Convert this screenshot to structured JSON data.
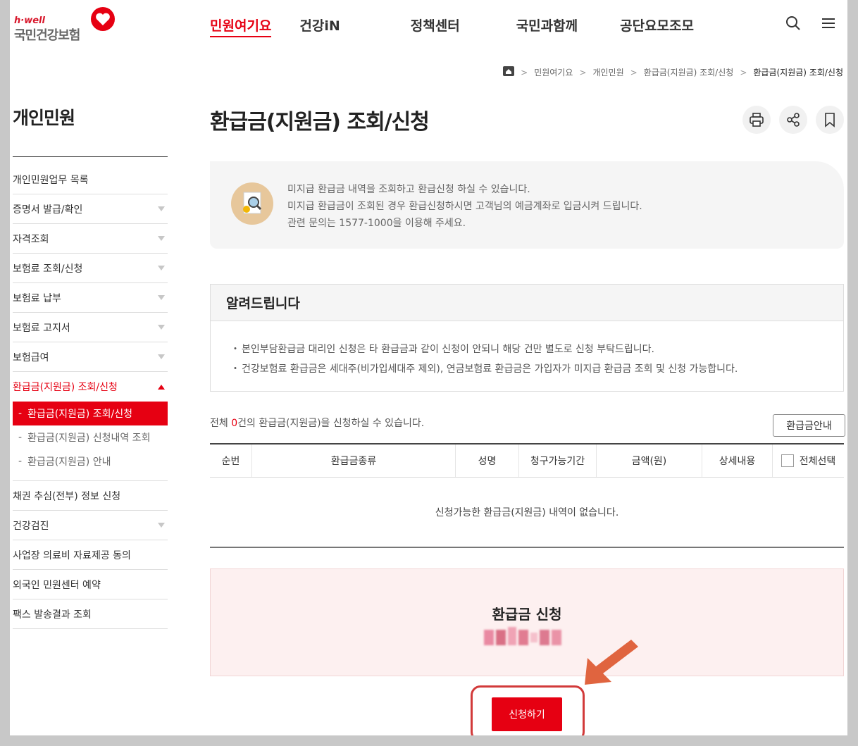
{
  "header": {
    "brand_small": "h·well",
    "brand_name": "국민건강보험",
    "nav": [
      "민원여기요",
      "건강iN",
      "정책센터",
      "국민과함께",
      "공단요모조모"
    ]
  },
  "breadcrumb": [
    "민원여기요",
    "개인민원",
    "환급금(지원금) 조회/신청",
    "환급금(지원금) 조회/신청"
  ],
  "sidebar": {
    "title": "개인민원",
    "items": [
      {
        "label": "개인민원업무 목록"
      },
      {
        "label": "증명서 발급/확인"
      },
      {
        "label": "자격조회"
      },
      {
        "label": "보험료 조회/신청"
      },
      {
        "label": "보험료 납부"
      },
      {
        "label": "보험료 고지서"
      },
      {
        "label": "보험급여"
      },
      {
        "label": "환급금(지원금) 조회/신청"
      },
      {
        "label": "채권 추심(전부) 정보 신청"
      },
      {
        "label": "건강검진"
      },
      {
        "label": "사업장 의료비 자료제공 동의"
      },
      {
        "label": "외국인 민원센터 예약"
      },
      {
        "label": "팩스 발송결과 조회"
      }
    ],
    "subitems": [
      {
        "label": "환급금(지원금) 조회/신청"
      },
      {
        "label": "환급금(지원금) 신청내역 조회"
      },
      {
        "label": "환급금(지원금) 안내"
      }
    ]
  },
  "main": {
    "title": "환급금(지원금) 조회/신청",
    "intro_lines": [
      "미지급 환급금 내역을 조회하고 환급신청 하실 수 있습니다.",
      "미지급 환급금이 조회된 경우 환급신청하시면 고객님의 예금계좌로 입금시켜 드립니다.",
      "관련 문의는 1577-1000을 이용해 주세요."
    ],
    "notice_title": "알려드립니다",
    "notice_items": [
      "본인부담환급금 대리인 신청은 타 환급금과 같이 신청이 안되니 해당 건만 별도로 신청 부탁드립니다.",
      "건강보험료 환급금은 세대주(비가입세대주 제외), 연금보험료 환급금은 가입자가 미지급 환급금 조회 및 신청 가능합니다."
    ],
    "count_prefix": "전체 ",
    "count_value": "0",
    "count_suffix": "건의 환급금(지원금)을 신청하실 수 있습니다.",
    "guide_button": "환급금안내",
    "table_headers": [
      "순번",
      "환급금종류",
      "성명",
      "청구가능기간",
      "금액(원)",
      "상세내용",
      "전체선택"
    ],
    "empty_message": "신청가능한 환급금(지원금) 내역이 없습니다.",
    "apply_title": "환급금 신청",
    "submit_label": "신청하기"
  },
  "colors": {
    "accent": "#e60012",
    "apply_bg": "#fdf0f0",
    "annotation": "#d23a3a",
    "arrow": "#e0643f"
  }
}
